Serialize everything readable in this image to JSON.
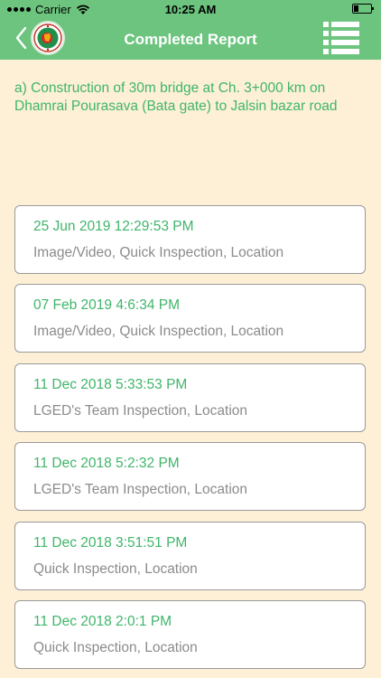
{
  "status_bar": {
    "carrier": "Carrier",
    "time": "10:25 AM",
    "icons": [
      "signal-dots-icon",
      "wifi-icon",
      "battery-icon"
    ]
  },
  "nav": {
    "title": "Completed Report",
    "back_icon": "chevron-left-icon",
    "logo": "government-emblem-logo",
    "menu_icon": "list-menu-icon",
    "bar_color": "#6cc47e"
  },
  "project": {
    "title": "a) Construction of 30m bridge at Ch. 3+000 km on Dhamrai Pourasava (Bata gate) to Jalsin bazar road"
  },
  "reports": [
    {
      "date": "25 Jun 2019 12:29:53 PM",
      "types": "Image/Video, Quick Inspection, Location"
    },
    {
      "date": "07 Feb 2019 4:6:34 PM",
      "types": "Image/Video, Quick Inspection, Location"
    },
    {
      "date": "11 Dec 2018 5:33:53 PM",
      "types": "LGED's Team Inspection, Location"
    },
    {
      "date": "11 Dec 2018 5:2:32 PM",
      "types": "LGED's Team Inspection, Location"
    },
    {
      "date": "11 Dec 2018 3:51:51 PM",
      "types": "Quick Inspection, Location"
    },
    {
      "date": "11 Dec 2018 2:0:1 PM",
      "types": "Quick Inspection, Location"
    }
  ],
  "colors": {
    "accent_green": "#3fb56a",
    "background": "#fdf0d6",
    "secondary_text": "#8b8b8b"
  }
}
